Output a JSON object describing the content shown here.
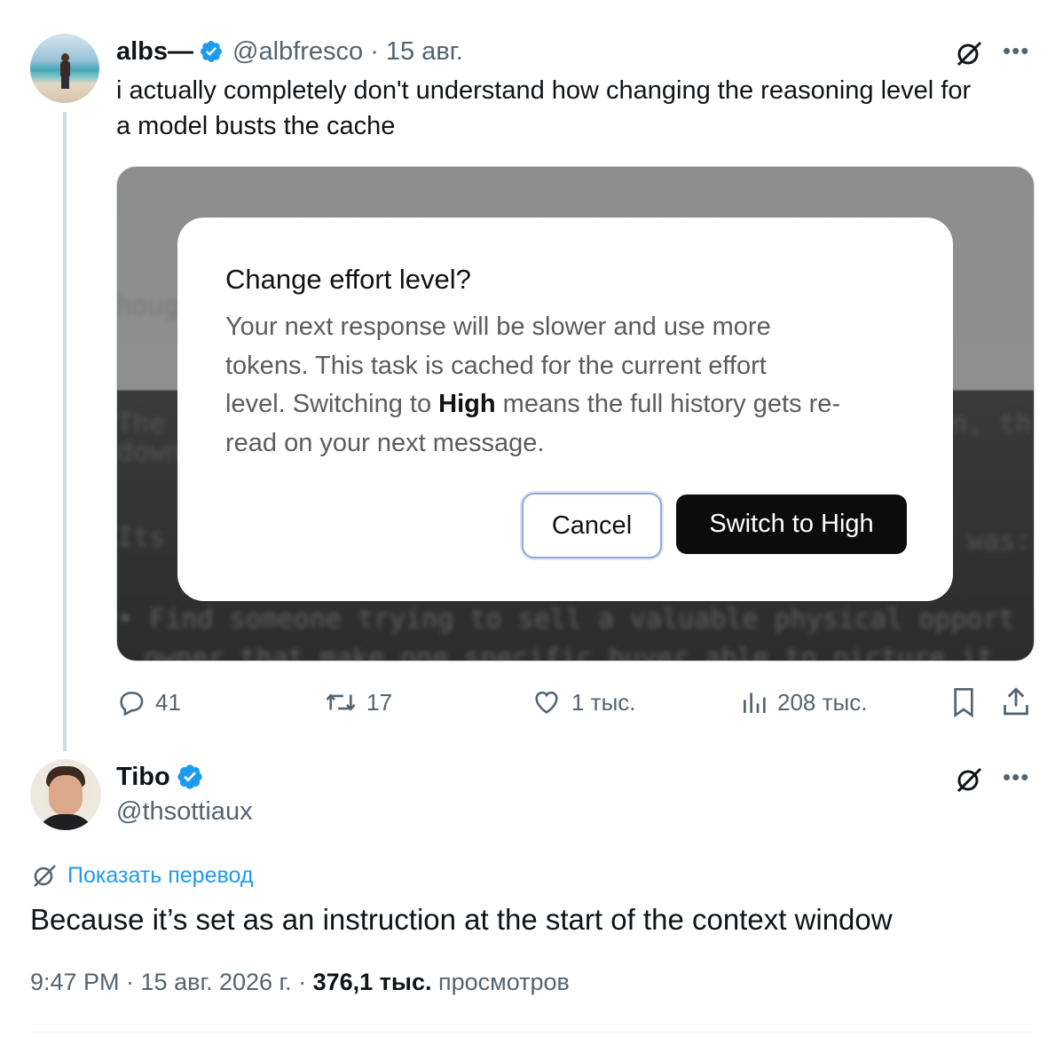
{
  "first_tweet": {
    "name": "albs—",
    "handle": "@albfresco",
    "date": "· 15 авг.",
    "text_line1": "i actually completely don't understand how changing the reasoning level for",
    "text_line2": "a model busts the cache",
    "image": {
      "dialog_title": "Change effort level?",
      "dialog_body_1": "Your next response will be slower and use more",
      "dialog_body_2": "tokens. This task is cached for the current effort",
      "dialog_body_3a": "level. Switching to ",
      "dialog_body_3b": "High",
      "dialog_body_3c": " means the full history gets re-",
      "dialog_body_4": "read on your next message.",
      "cancel_label": "Cancel",
      "switch_label": "Switch to High",
      "blurred_bg": [
        "houg",
        "The",
        "down",
        "n, th",
        "Its",
        "was:",
        "• Find someone trying to sell a valuable physical opport",
        "owner that make one specific buyer able to picture it"
      ]
    },
    "actions": {
      "replies": "41",
      "reposts": "17",
      "likes": "1 тыс.",
      "views": "208 тыс."
    }
  },
  "second_tweet": {
    "name": "Tibo",
    "handle": "@thsottiaux",
    "translate_label": "Показать перевод",
    "text": "Because it’s set as an instruction at the start of the context window",
    "meta_time": "9:47 PM · 15 авг. 2026 г. · ",
    "meta_views_count": "376,1 тыс.",
    "meta_views_label": " просмотров"
  },
  "icons": {
    "more": "more-options-icon",
    "grok": "grok-icon",
    "verified_color": "#1d9bf0"
  }
}
